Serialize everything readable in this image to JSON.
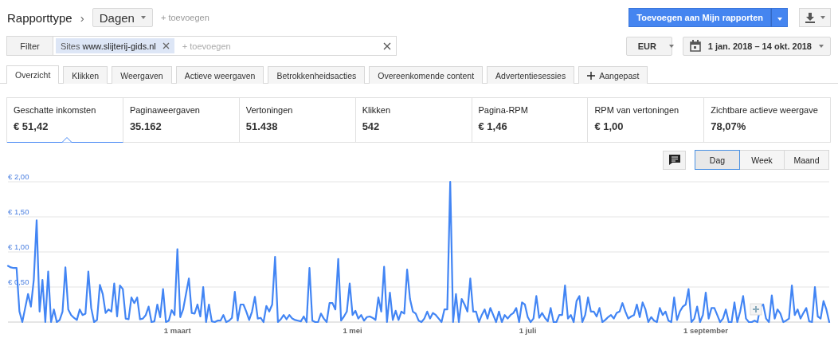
{
  "header": {
    "title": "Rapporttype",
    "separator": "›",
    "dimension": "Dagen",
    "add_link": "+ toevoegen",
    "save_button": "Toevoegen aan Mijn rapporten"
  },
  "filter": {
    "button": "Filter",
    "chips": [
      {
        "label": "Sites",
        "value": "www.slijterij-gids.nl"
      }
    ],
    "placeholder": "+ toevoegen"
  },
  "currency": "EUR",
  "date_range": "1 jan. 2018 – 14 okt. 2018",
  "tabs": [
    {
      "label": "Overzicht",
      "selected": true
    },
    {
      "label": "Klikken",
      "selected": false
    },
    {
      "label": "Weergaven",
      "selected": false
    },
    {
      "label": "Actieve weergaven",
      "selected": false
    },
    {
      "label": "Betrokkenheidsacties",
      "selected": false
    },
    {
      "label": "Overeenkomende content",
      "selected": false
    },
    {
      "label": "Advertentiesessies",
      "selected": false
    }
  ],
  "custom_tab": "Aangepast",
  "metrics": [
    {
      "label": "Geschatte inkomsten",
      "value": "€ 51,42",
      "selected": true
    },
    {
      "label": "Paginaweergaven",
      "value": "35.162",
      "selected": false
    },
    {
      "label": "Vertoningen",
      "value": "51.438",
      "selected": false
    },
    {
      "label": "Klikken",
      "value": "542",
      "selected": false
    },
    {
      "label": "Pagina-RPM",
      "value": "€ 1,46",
      "selected": false
    },
    {
      "label": "RPM van vertoningen",
      "value": "€ 1,00",
      "selected": false
    },
    {
      "label": "Zichtbare actieve weergave",
      "value": "78,07%",
      "selected": false
    }
  ],
  "granularity": [
    {
      "label": "Dag",
      "selected": true
    },
    {
      "label": "Week",
      "selected": false
    },
    {
      "label": "Maand",
      "selected": false
    }
  ],
  "chart": {
    "x_axis_labels": [
      "1 maart",
      "1 mei",
      "1 juli",
      "1 september"
    ],
    "chart_data": {
      "type": "line",
      "grid": true,
      "ylim": [
        0,
        2
      ],
      "yticks": [
        {
          "value": 0.5,
          "label": "€ 0,50"
        },
        {
          "value": 1,
          "label": "€ 1,00"
        },
        {
          "value": 1.5,
          "label": "€ 1,50"
        },
        {
          "value": 2,
          "label": "€ 2,00"
        }
      ],
      "series": [
        {
          "color": "#4285f4",
          "values": [
            0.8,
            0.78,
            0.77,
            0.77,
            0.15,
            0.0,
            0.2,
            0.4,
            0.22,
            0.6,
            1.45,
            0.15,
            0.6,
            0.0,
            0.72,
            0.0,
            0.18,
            0.0,
            0.03,
            0.15,
            0.78,
            0.18,
            0.1,
            0.06,
            0.03,
            0.18,
            0.1,
            0.12,
            0.72,
            0.2,
            0.0,
            0.03,
            0.53,
            0.4,
            0.13,
            0.18,
            0.15,
            0.55,
            0.08,
            0.52,
            0.47,
            0.05,
            0.04,
            0.35,
            0.27,
            0.35,
            0.04,
            0.05,
            0.1,
            0.22,
            0.0,
            0.01,
            0.25,
            0.07,
            0.47,
            0.0,
            0.02,
            0.17,
            0.1,
            1.04,
            0.07,
            0.18,
            0.4,
            0.62,
            0.13,
            0.12,
            0.25,
            0.08,
            0.5,
            0.0,
            0.25,
            0.01,
            0.0,
            0.02,
            0.02,
            0.1,
            0.0,
            0.02,
            0.06,
            0.43,
            0.02,
            0.25,
            0.25,
            0.15,
            0.03,
            0.15,
            0.36,
            0.05,
            0.06,
            0.0,
            0.23,
            0.15,
            0.25,
            0.93,
            0.0,
            0.04,
            0.1,
            0.04,
            0.1,
            0.05,
            0.03,
            0.02,
            0.01,
            0.08,
            0.0,
            0.77,
            0.02,
            0.0,
            0.0,
            0.12,
            0.05,
            0.0,
            0.27,
            0.27,
            0.18,
            0.9,
            0.02,
            0.08,
            0.15,
            0.55,
            0.1,
            0.16,
            0.05,
            0.1,
            0.02,
            0.07,
            0.08,
            0.06,
            0.03,
            0.35,
            0.15,
            0.79,
            0.0,
            0.42,
            0.03,
            0.16,
            0.03,
            0.15,
            0.12,
            0.75,
            0.33,
            0.15,
            0.12,
            0.02,
            0.0,
            0.05,
            0.15,
            0.05,
            0.13,
            0.1,
            0.05,
            0.0,
            0.18,
            0.18,
            2.0,
            0.0,
            0.4,
            0.0,
            0.33,
            0.25,
            0.15,
            0.62,
            0.15,
            0.15,
            0.0,
            0.1,
            0.18,
            0.05,
            0.2,
            0.1,
            0.0,
            0.15,
            0.0,
            0.1,
            0.05,
            0.1,
            0.13,
            0.2,
            0.0,
            0.28,
            0.25,
            0.07,
            0.0,
            0.05,
            0.37,
            0.06,
            0.13,
            0.06,
            0.01,
            0.2,
            0.0,
            0.0,
            0.1,
            0.1,
            0.52,
            0.05,
            0.1,
            0.0,
            0.3,
            0.37,
            0.0,
            0.1,
            0.35,
            0.15,
            0.15,
            0.08,
            0.2,
            0.0,
            0.03,
            0.07,
            0.1,
            0.05,
            0.13,
            0.15,
            0.27,
            0.15,
            0.05,
            0.08,
            0.1,
            0.25,
            0.07,
            0.28,
            0.18,
            0.0,
            0.07,
            0.02,
            0.0,
            0.2,
            0.1,
            0.15,
            0.02,
            0.0,
            0.35,
            0.03,
            0.15,
            0.22,
            0.25,
            0.47,
            0.0,
            0.05,
            0.22,
            0.0,
            0.1,
            0.42,
            0.05,
            0.2,
            0.2,
            0.1,
            0.0,
            0.05,
            0.18,
            0.0,
            0.0,
            0.28,
            0.0,
            0.15,
            0.37,
            0.05,
            0.0,
            0.0,
            0.02,
            0.0,
            0.22,
            0.25,
            0.05,
            0.0,
            0.38,
            0.05,
            0.18,
            0.12,
            0.0,
            0.02,
            0.05,
            0.52,
            0.1,
            0.18,
            0.05,
            0.13,
            0.2,
            0.01,
            0.0,
            0.5,
            0.08,
            0.05,
            0.3,
            0.18,
            0.0
          ]
        }
      ]
    }
  }
}
